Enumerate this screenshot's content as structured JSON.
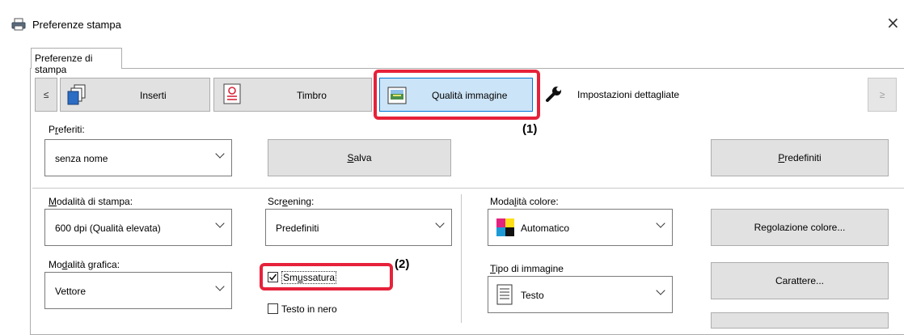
{
  "window": {
    "title": "Preferenze stampa",
    "close_glyph": "×",
    "printer_icon": "printer-icon"
  },
  "tab": {
    "label": "Preferenze di stampa"
  },
  "toolbar": {
    "prev_glyph": "≤",
    "next_glyph": "≥",
    "buttons": [
      {
        "label": "Inserti",
        "icon": "inserts-icon"
      },
      {
        "label": "Timbro",
        "icon": "stamp-icon"
      },
      {
        "label": "Qualità immagine",
        "icon": "image-quality-icon",
        "active": true
      },
      {
        "label": "Impostazioni dettagliate",
        "icon": "wrench-icon"
      }
    ]
  },
  "callouts": {
    "one": "(1)",
    "two": "(2)"
  },
  "favorites": {
    "label_pre": "P",
    "label_u": "r",
    "label_post": "eferiti:",
    "value": "senza nome",
    "save_pre": "",
    "save_u": "S",
    "save_post": "alva",
    "defaults_pre": "",
    "defaults_u": "P",
    "defaults_post": "redefiniti"
  },
  "print_mode": {
    "label_pre": "",
    "label_u": "M",
    "label_post": "odalità di stampa:",
    "value": "600 dpi (Qualità elevata)"
  },
  "screening": {
    "label_pre": "Scr",
    "label_u": "e",
    "label_post": "ening:",
    "value": "Predefiniti"
  },
  "color_mode": {
    "label_pre": "Moda",
    "label_u": "l",
    "label_post": "ità colore:",
    "value": "Automatico"
  },
  "color_adjust": {
    "pre": "Re",
    "u": "g",
    "post": "olazione colore..."
  },
  "graphic_mode": {
    "label_pre": "Mo",
    "label_u": "d",
    "label_post": "alità grafica:",
    "value": "Vettore"
  },
  "smoothing": {
    "pre": "Sm",
    "u": "u",
    "post": "ssatura",
    "checked": true
  },
  "text_black": {
    "label": "Testo in nero",
    "checked": false
  },
  "image_type": {
    "label_pre": "",
    "label_u": "T",
    "label_post": "ipo di immagine",
    "value": "Testo"
  },
  "font_button": {
    "label": "Carattere..."
  }
}
